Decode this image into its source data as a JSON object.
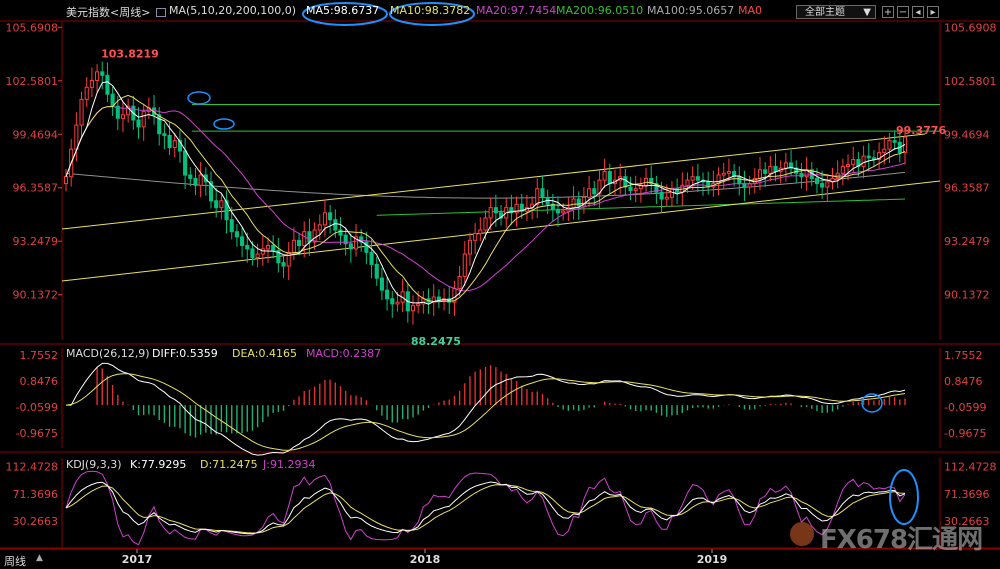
{
  "header": {
    "title": "美元指数<周线>",
    "ma_params": "MA(5,10,20,200,100,0)",
    "ma5": "MA5:98.6737",
    "ma10": "MA10:98.3782",
    "ma20": "MA20:97.7454",
    "ma200": "MA200:96.0510",
    "ma100": "MA100:95.0657",
    "ma0": "MA0",
    "dropdown": "全部主题"
  },
  "footer": {
    "tab": "周线"
  },
  "watermark": "FX678汇通网",
  "colors": {
    "up": "#ff3b3b",
    "down": "#00c080",
    "ma5": "#ffffff",
    "ma10": "#e8e060",
    "ma20": "#d040d0",
    "ma200": "#30c030",
    "ma100": "#909090",
    "trend": "#e8e060",
    "hline": "#30c030",
    "circle": "#1e90ff",
    "axis": "#8b0000"
  },
  "chart_data": [
    {
      "type": "candlestick",
      "title": "美元指数<周线>",
      "y_axis_ticks": [
        "105.6908",
        "102.5801",
        "99.4694",
        "96.3587",
        "93.2479",
        "90.1372"
      ],
      "ylim": [
        87.5,
        106.0
      ],
      "x_labels": [
        "2017",
        "2018",
        "2019"
      ],
      "annotations": {
        "high": "103.8219",
        "low": "88.2475",
        "last": "99.3776"
      },
      "horizontal_levels": [
        101.2,
        99.65
      ],
      "close_series": [
        97.0,
        98.6,
        100.0,
        101.5,
        102.2,
        102.6,
        103.1,
        102.9,
        101.8,
        101.1,
        100.4,
        100.6,
        101.1,
        100.3,
        99.9,
        100.8,
        101.0,
        100.6,
        99.5,
        99.4,
        98.7,
        99.1,
        98.5,
        97.1,
        96.9,
        96.5,
        97.1,
        96.7,
        95.6,
        95.2,
        95.6,
        94.5,
        93.8,
        93.5,
        93.0,
        92.8,
        92.3,
        92.5,
        92.8,
        93.0,
        92.7,
        92.0,
        91.8,
        92.6,
        93.3,
        93.0,
        93.8,
        93.2,
        93.9,
        94.2,
        94.9,
        94.5,
        93.9,
        93.6,
        93.1,
        92.8,
        93.5,
        93.2,
        92.6,
        91.9,
        91.1,
        90.4,
        89.9,
        89.6,
        89.7,
        90.3,
        89.2,
        89.5,
        89.6,
        89.9,
        89.7,
        90.0,
        89.8,
        89.9,
        89.7,
        90.5,
        91.2,
        92.5,
        93.3,
        93.7,
        93.9,
        94.6,
        95.2,
        94.9,
        94.6,
        95.2,
        94.9,
        95.4,
        95.0,
        95.2,
        95.4,
        96.3,
        95.8,
        95.4,
        95.1,
        94.9,
        95.0,
        95.2,
        95.7,
        95.3,
        95.8,
        96.3,
        96.0,
        96.8,
        97.3,
        96.6,
        96.8,
        97.0,
        96.4,
        96.2,
        96.3,
        96.5,
        96.9,
        96.6,
        96.1,
        95.7,
        95.8,
        96.3,
        96.1,
        96.5,
        96.8,
        97.0,
        96.8,
        96.7,
        96.4,
        96.6,
        97.1,
        97.2,
        97.3,
        97.0,
        96.6,
        96.4,
        96.6,
        96.9,
        97.4,
        97.2,
        97.6,
        97.3,
        97.5,
        97.8,
        97.5,
        97.2,
        97.0,
        97.4,
        96.9,
        96.6,
        96.4,
        96.7,
        96.9,
        97.2,
        97.6,
        97.7,
        98.0,
        97.6,
        98.2,
        98.1,
        98.0,
        98.4,
        98.6,
        99.1,
        99.0,
        98.4,
        99.3
      ]
    },
    {
      "type": "line",
      "title": "MACD(26,12,9)",
      "series_labels": {
        "diff": "DIFF:0.5359",
        "dea": "DEA:0.4165",
        "macd": "MACD:0.2387"
      },
      "y_axis_ticks": [
        "1.7552",
        "0.8476",
        "-0.0599",
        "-0.9675"
      ],
      "ylim": [
        -1.5,
        2.0
      ],
      "values": {
        "diff": 0.5359,
        "dea": 0.4165,
        "macd": 0.2387
      }
    },
    {
      "type": "line",
      "title": "KDJ(9,3,3)",
      "series_labels": {
        "k": "K:77.9295",
        "d": "D:71.2475",
        "j": "J:91.2934"
      },
      "y_axis_ticks": [
        "112.4728",
        "71.3696",
        "30.2663"
      ],
      "ylim": [
        -10,
        125
      ],
      "values": {
        "k": 77.9295,
        "d": 71.2475,
        "j": 91.2934
      }
    }
  ]
}
